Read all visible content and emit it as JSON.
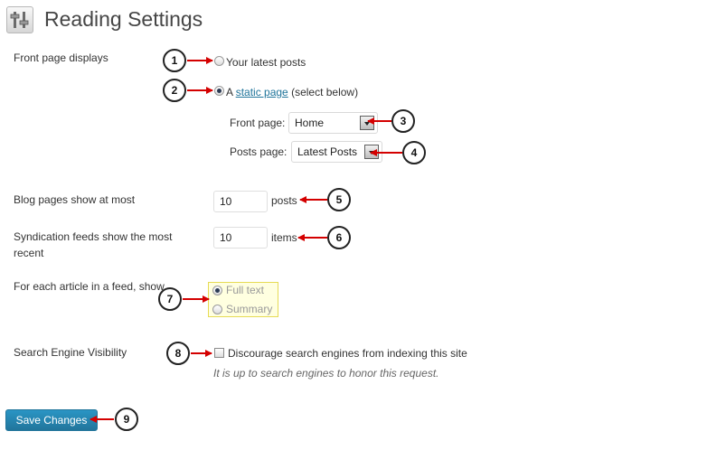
{
  "page": {
    "title": "Reading Settings",
    "title_icon": "settings-sliders-icon"
  },
  "front_page": {
    "label": "Front page displays",
    "option_latest": "Your latest posts",
    "option_static_prefix": "A ",
    "option_static_link": "static page",
    "option_static_suffix": " (select below)",
    "selected": "static",
    "front_page_label": "Front page:",
    "front_page_value": "Home",
    "posts_page_label": "Posts page:",
    "posts_page_value": "Latest Posts"
  },
  "blog_pages": {
    "label": "Blog pages show at most",
    "value": "10",
    "unit": "posts"
  },
  "syndication": {
    "label": "Syndication feeds show the most recent",
    "value": "10",
    "unit": "items"
  },
  "feed_article": {
    "label": "For each article in a feed, show",
    "option_full": "Full text",
    "option_summary": "Summary",
    "selected": "full"
  },
  "search_visibility": {
    "label": "Search Engine Visibility",
    "checkbox_label": "Discourage search engines from indexing this site",
    "checked": false,
    "hint": "It is up to search engines to honor this request."
  },
  "save_button": "Save Changes",
  "callouts": [
    "1",
    "2",
    "3",
    "4",
    "5",
    "6",
    "7",
    "8",
    "9"
  ],
  "colors": {
    "link": "#21759b",
    "button": "#21759b",
    "arrow": "#d40000",
    "feed_box_bg": "#ffffe0"
  }
}
